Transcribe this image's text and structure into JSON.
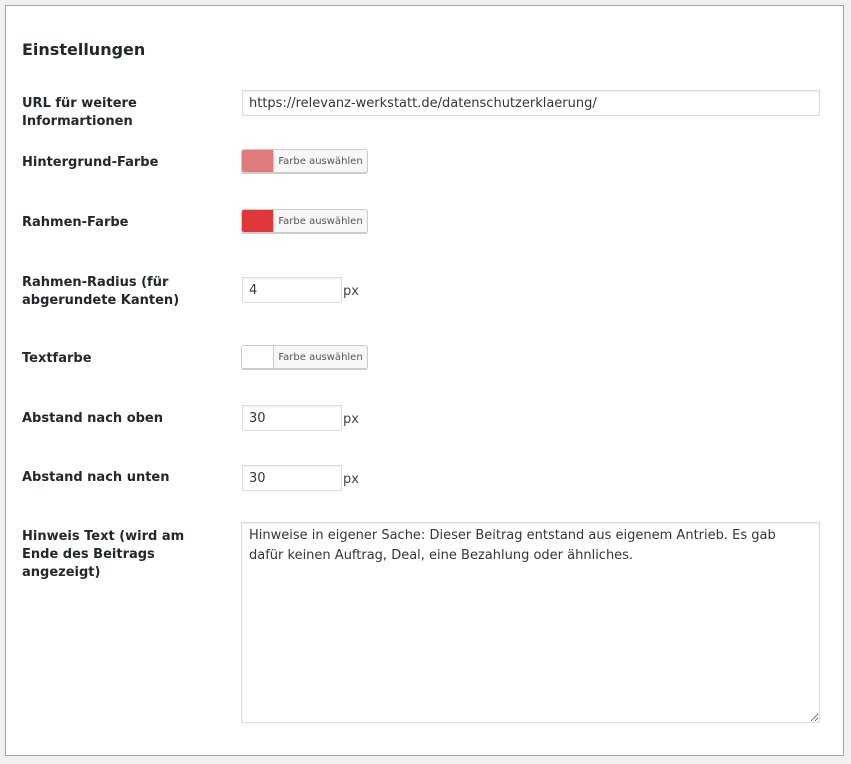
{
  "section": {
    "title": "Einstellungen"
  },
  "fields": {
    "url": {
      "label": "URL für weitere Informartionen",
      "value": "https://relevanz-werkstatt.de/datenschutzerklaerung/"
    },
    "background_color": {
      "label": "Hintergrund-Farbe",
      "button_label": "Farbe auswählen",
      "color": "#e07b7b"
    },
    "border_color": {
      "label": "Rahmen-Farbe",
      "button_label": "Farbe auswählen",
      "color": "#e0373a"
    },
    "border_radius": {
      "label": "Rahmen-Radius (für abgerundete Kanten)",
      "value": "4",
      "unit": "px"
    },
    "text_color": {
      "label": "Textfarbe",
      "button_label": "Farbe auswählen",
      "color": "#ffffff"
    },
    "margin_top": {
      "label": "Abstand nach oben",
      "value": "30",
      "unit": "px"
    },
    "margin_bottom": {
      "label": "Abstand nach unten",
      "value": "30",
      "unit": "px"
    },
    "notice_text": {
      "label": "Hinweis Text (wird am Ende des Beitrags angezeigt)",
      "value": "Hinweise in eigener Sache: Dieser Beitrag entstand aus eigenem Antrieb. Es gab dafür keinen Auftrag, Deal, eine Bezahlung oder ähnliches."
    }
  }
}
